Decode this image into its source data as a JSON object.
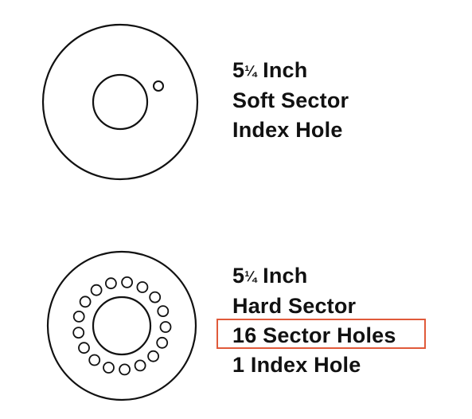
{
  "soft_sector": {
    "size_whole": "5",
    "size_fraction": "1/4",
    "size_unit": "Inch",
    "line2": "Soft Sector",
    "line3": "Index Hole"
  },
  "hard_sector": {
    "size_whole": "5",
    "size_fraction": "1/4",
    "size_unit": "Inch",
    "line2": "Hard Sector",
    "line3": "16 Sector Holes",
    "line4": "1 Index Hole",
    "sector_hole_count": 16,
    "index_hole_count": 1
  },
  "colors": {
    "stroke": "#111111",
    "highlight": "#e05a3a"
  }
}
